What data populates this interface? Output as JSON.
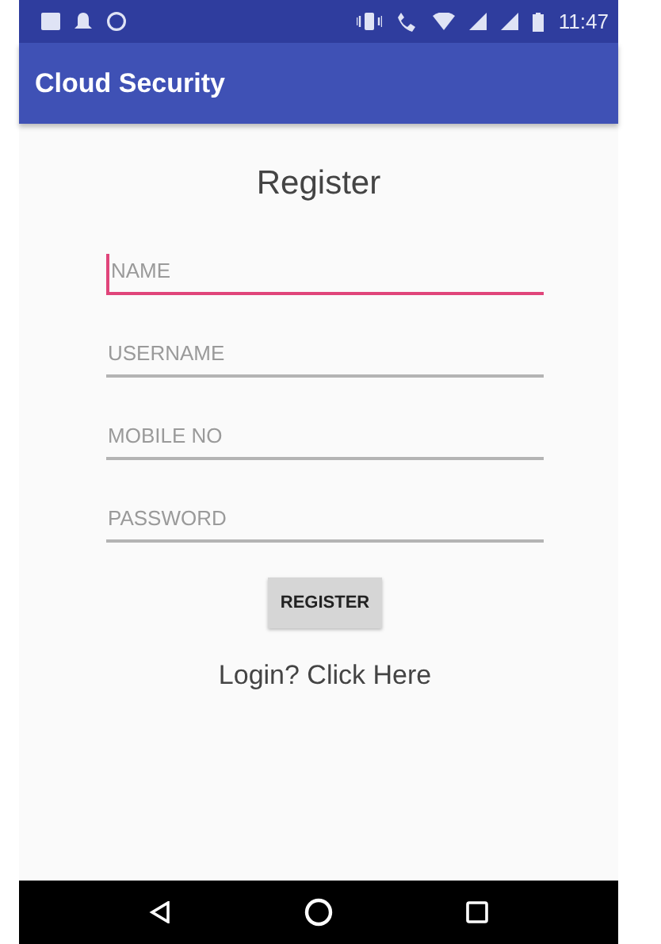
{
  "status_bar": {
    "time": "11:47"
  },
  "app_bar": {
    "title": "Cloud Security"
  },
  "form": {
    "heading": "Register",
    "fields": [
      {
        "placeholder": "NAME",
        "focused": true
      },
      {
        "placeholder": "USERNAME",
        "focused": false
      },
      {
        "placeholder": "MOBILE NO",
        "focused": false
      },
      {
        "placeholder": "PASSWORD",
        "focused": false
      }
    ],
    "button": "REGISTER",
    "link": "Login? Click Here"
  }
}
